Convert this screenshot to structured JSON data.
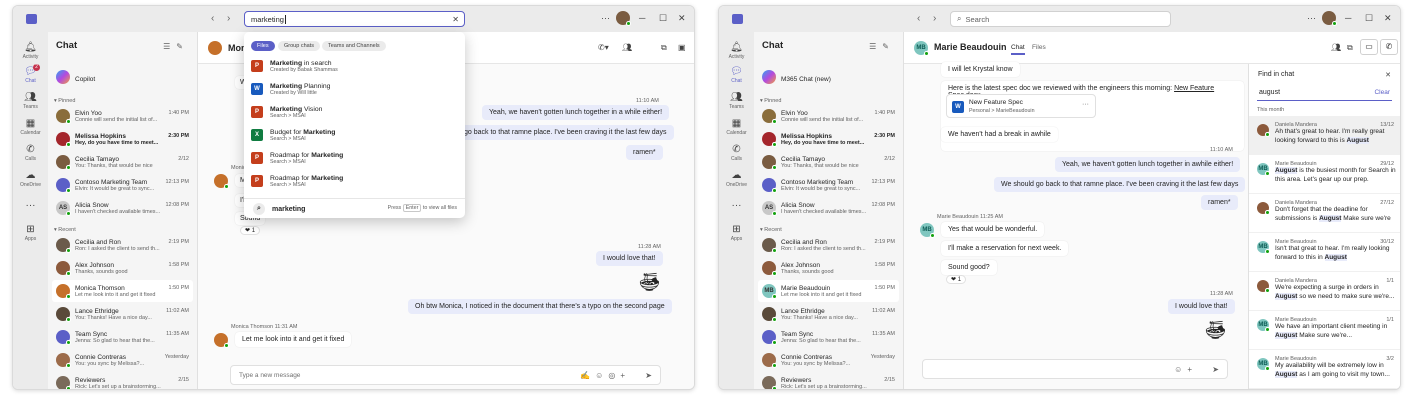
{
  "window1": {
    "search_value": "marketing",
    "rail": [
      {
        "label": "Activity",
        "icon": "bell-icon"
      },
      {
        "label": "Chat",
        "icon": "chat-icon",
        "badge": "2"
      },
      {
        "label": "Teams",
        "icon": "teams-icon"
      },
      {
        "label": "Calendar",
        "icon": "calendar-icon"
      },
      {
        "label": "Calls",
        "icon": "phone-icon"
      },
      {
        "label": "OneDrive",
        "icon": "cloud-icon"
      },
      {
        "label": "Apps",
        "icon": "apps-icon"
      }
    ],
    "chat_title": "Chat",
    "copilot": "Copilot",
    "pinned_label": "Pinned",
    "recent_label": "Recent",
    "pinned": [
      {
        "name": "Elvin Yoo",
        "preview": "Connie will send the initial list of...",
        "time": "1:40 PM",
        "color": "#8a6d3b",
        "bold": false
      },
      {
        "name": "Melissa Hopkins",
        "preview": "Hey, do you have time to meet...",
        "time": "2:30 PM",
        "color": "#a4262c",
        "bold": true
      },
      {
        "name": "Cecilia Tamayo",
        "preview": "You: Thanks, that would be nice",
        "time": "2/12",
        "color": "#7a5c41",
        "bold": false
      },
      {
        "name": "Contoso Marketing Team",
        "preview": "Elvin: It would be great to sync...",
        "time": "12:13 PM",
        "color": "#5b5fc7",
        "bold": false
      },
      {
        "name": "Alicia Snow",
        "preview": "I haven't checked available times...",
        "time": "12:08 PM",
        "color": "#c8c8c8",
        "initials": "AS",
        "bold": false
      }
    ],
    "recent": [
      {
        "name": "Cecilia and Ron",
        "preview": "Ron: I asked the client to send th...",
        "time": "2:19 PM",
        "color": "#6b5b4b"
      },
      {
        "name": "Alex Johnson",
        "preview": "Thanks, sounds good",
        "time": "1:58 PM",
        "color": "#8c5a3c"
      },
      {
        "name": "Monica Thomson",
        "preview": "Let me look into it and get it fixed",
        "time": "1:50 PM",
        "color": "#c5702a"
      },
      {
        "name": "Lance Ethridge",
        "preview": "You: Thanks! Have a nice day...",
        "time": "11:02 AM",
        "color": "#5a4a3a"
      },
      {
        "name": "Team Sync",
        "preview": "Jenna: So glad to hear that the...",
        "time": "11:35 AM",
        "color": "#5b5fc7"
      },
      {
        "name": "Connie Contreras",
        "preview": "You: you sync by Melissa?...",
        "time": "Yesterday",
        "color": "#9c6b4a"
      },
      {
        "name": "Reviewers",
        "preview": "Rick: Let's set up a brainstorming...",
        "time": "2/15",
        "color": "#7a6a5a"
      }
    ],
    "header_name": "Monica Thomson",
    "filters": [
      "Files",
      "Group chats",
      "Teams and Channels"
    ],
    "results": [
      {
        "title_bold": "Marketing",
        "title_rest": " in search",
        "sub": "Created by Babak Shammas",
        "type": "ppt"
      },
      {
        "title_bold": "Marketing",
        "title_rest": " Planning",
        "sub": "Created by Will little",
        "type": "word"
      },
      {
        "title_bold": "Marketing",
        "title_rest": " Vision",
        "sub": "Search > MSAI",
        "type": "ppt"
      },
      {
        "title_pre": "Budget for ",
        "title_bold": "Marketing",
        "title_rest": "",
        "sub": "Search > MSAI",
        "type": "excel"
      },
      {
        "title_pre": "Roadmap for ",
        "title_bold": "Marketing",
        "title_rest": "",
        "sub": "Search > MSAI",
        "type": "ppt"
      },
      {
        "title_pre": "Roadmap for ",
        "title_bold": "Marketing",
        "title_rest": "",
        "sub": "Search > MSAI",
        "type": "ppt"
      }
    ],
    "search_all_label": "marketing",
    "press_label": "Press",
    "enter_key": "Enter",
    "view_all_label": "to view all files",
    "messages": {
      "t1": "11:10 AM",
      "m1": "Yeah, we haven't gotten lunch together in a while either!",
      "m2": "go back to that ramne place. I've been craving it the last few days",
      "m3": "ramen*",
      "t2": "11:28 AM",
      "m4": "I would love that!",
      "m5": "Oh btw Monica, I noticed in the document that there's a typo on the second page",
      "sender": "Monica Thomson  11:31 AM",
      "m6": "Let me look into it and get it fixed",
      "p_monica": "Monica",
      "p_ill": "I'll",
      "p_sound": "Sound",
      "p_w": "W",
      "reaction": "1"
    },
    "composer_placeholder": "Type a new message"
  },
  "window2": {
    "search_placeholder": "Search",
    "chat_title": "Chat",
    "copilot": "M365 Chat (new)",
    "pinned_label": "Pinned",
    "recent_label": "Recent",
    "pinned": [
      {
        "name": "Elvin Yoo",
        "preview": "Connie will send the initial list of...",
        "time": "1:40 PM",
        "color": "#8a6d3b",
        "bold": false
      },
      {
        "name": "Melissa Hopkins",
        "preview": "Hey, do you have time to meet...",
        "time": "2:30 PM",
        "color": "#a4262c",
        "bold": true
      },
      {
        "name": "Cecilia Tamayo",
        "preview": "You: Thanks, that would be nice",
        "time": "2/12",
        "color": "#7a5c41",
        "bold": false
      },
      {
        "name": "Contoso Marketing Team",
        "preview": "Elvin: It would be great to sync...",
        "time": "12:13 PM",
        "color": "#5b5fc7",
        "bold": false
      },
      {
        "name": "Alicia Snow",
        "preview": "I haven't checked available times...",
        "time": "12:08 PM",
        "color": "#c8c8c8",
        "initials": "AS",
        "bold": false
      }
    ],
    "recent": [
      {
        "name": "Cecilia and Ron",
        "preview": "Ron: I asked the client to send th...",
        "time": "2:19 PM",
        "color": "#6b5b4b"
      },
      {
        "name": "Alex Johnson",
        "preview": "Thanks, sounds good",
        "time": "1:58 PM",
        "color": "#8c5a3c"
      },
      {
        "name": "Marie Beaudouin",
        "preview": "Let me look into it and get it fixed",
        "time": "1:50 PM",
        "color": "#7fc6bf",
        "initials": "MB"
      },
      {
        "name": "Lance Ethridge",
        "preview": "You: Thanks! Have a nice day...",
        "time": "11:02 AM",
        "color": "#5a4a3a"
      },
      {
        "name": "Team Sync",
        "preview": "Jenna: So glad to hear that the...",
        "time": "11:35 AM",
        "color": "#5b5fc7"
      },
      {
        "name": "Connie Contreras",
        "preview": "You: you sync by Melissa?...",
        "time": "Yesterday",
        "color": "#9c6b4a"
      },
      {
        "name": "Reviewers",
        "preview": "Rick: Let's set up a brainstorming...",
        "time": "2/15",
        "color": "#7a6a5a"
      }
    ],
    "header_name": "Marie Beaudouin",
    "header_initials": "MB",
    "tab_chat": "Chat",
    "tab_files": "Files",
    "messages": {
      "m0": "I will let Krystal know",
      "m1_pre": "Here is the latest spec doc we reviewed with the engineers this morning: ",
      "m1_link": "New Feature Spec.docx",
      "file_title": "New Feature Spec",
      "file_sub": "Personal > MarieBeaudouin",
      "m2": "We haven't had a break in awhile",
      "t1": "11:10 AM",
      "m3": "Yeah, we haven't gotten lunch together in awhile either!",
      "m4": "We should go back to that ramne place. I've been craving it the last few days",
      "m5": "ramen*",
      "sender": "Marie Beaudouin  11:25 AM",
      "m6": "Yes that would be wonderful.",
      "m7": "I'll make a reservation for next week.",
      "m8": "Sound good?",
      "reaction": "1",
      "t2": "11:28 AM",
      "m9": "I would love that!"
    },
    "find": {
      "title": "Find in chat",
      "query": "august",
      "clear": "Clear",
      "period": "This month",
      "results": [
        {
          "name": "Daniela Mandera",
          "date": "13/12",
          "pre": "Ah that's great to hear. I'm really great looking forward to this is ",
          "hl": "August",
          "post": "",
          "color": "#8c5a3c"
        },
        {
          "name": "Marie Beaudouin",
          "date": "29/12",
          "pre": "",
          "hl": "August",
          "post": " is the busiest month for Search in this area. Let's gear up our prep.",
          "color": "#7fc6bf",
          "initials": "MB"
        },
        {
          "name": "Daniela Mandera",
          "date": "27/12",
          "pre": "Don't forget that the deadline for submissions is ",
          "hl": "August",
          "post": " Make sure we're",
          "color": "#8c5a3c"
        },
        {
          "name": "Marie Beaudouin",
          "date": "30/12",
          "pre": "Isn't that great to hear. I'm really looking forward to this in ",
          "hl": "August",
          "post": "",
          "color": "#7fc6bf",
          "initials": "MB"
        },
        {
          "name": "Daniela Mandera",
          "date": "1/1",
          "pre": "We're expecting a surge in orders in ",
          "hl": "August",
          "post": " so we need to make sure we're...",
          "color": "#8c5a3c"
        },
        {
          "name": "Marie Beaudouin",
          "date": "1/1",
          "pre": "We have an important client meeting in ",
          "hl": "August",
          "post": " Make sure we're...",
          "color": "#7fc6bf",
          "initials": "MB"
        },
        {
          "name": "Marie Beaudouin",
          "date": "3/2",
          "pre": "My availability will be extremely low in ",
          "hl": "August",
          "post": " as I am going to visit my town...",
          "color": "#7fc6bf",
          "initials": "MB"
        }
      ]
    },
    "composer_placeholder": ""
  }
}
